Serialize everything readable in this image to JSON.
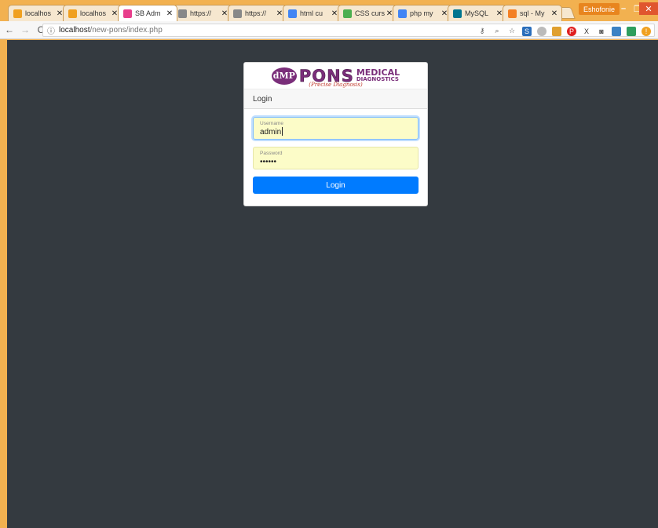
{
  "browser": {
    "tabs": [
      {
        "title": "localhos",
        "icon": "xampp-icon",
        "color": "#f0a020"
      },
      {
        "title": "localhos",
        "icon": "xampp-icon",
        "color": "#f0a020"
      },
      {
        "title": "SB Adm",
        "icon": "sb-admin-icon",
        "color": "#e83e8c",
        "active": true
      },
      {
        "title": "https://",
        "icon": "page-icon",
        "color": "#888888"
      },
      {
        "title": "https://",
        "icon": "page-icon",
        "color": "#888888"
      },
      {
        "title": "html cu",
        "icon": "google-icon",
        "color": "#4285f4"
      },
      {
        "title": "CSS curs",
        "icon": "w3-icon",
        "color": "#4caf50"
      },
      {
        "title": "php my",
        "icon": "google-icon",
        "color": "#4285f4"
      },
      {
        "title": "MySQL",
        "icon": "mysql-icon",
        "color": "#00758f"
      },
      {
        "title": "sql - My",
        "icon": "stackoverflow-icon",
        "color": "#f48024"
      }
    ],
    "tab_close_glyph": "✕",
    "profile_name": "Eshofonie",
    "url_host": "localhost",
    "url_path": "/new-pons/index.php"
  },
  "logo": {
    "mark": "dMP",
    "name": "PONS",
    "line1": "MEDICAL",
    "line2": "DIAGNOSTICS",
    "tagline": "(Precise Diagnosis)"
  },
  "login": {
    "header": "Login",
    "username_label": "Username",
    "username_value": "admin",
    "password_label": "Password",
    "password_value": "••••••",
    "submit_label": "Login"
  },
  "colors": {
    "page_bg": "#343a40",
    "primary": "#007bff",
    "autofill": "#fcfcc8",
    "brand": "#7a2e7a"
  }
}
